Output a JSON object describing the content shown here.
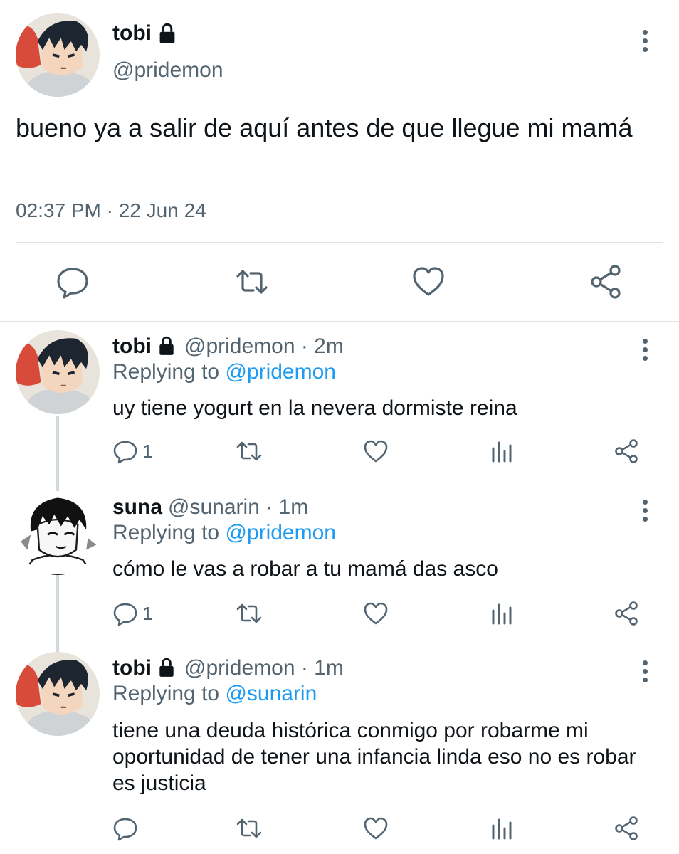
{
  "main_tweet": {
    "display_name": "tobi",
    "handle": "@pridemon",
    "text": "bueno ya a salir de aquí antes de que llegue mi mamá",
    "timestamp": "02:37 PM · 22 Jun 24",
    "icons": [
      "lock-icon",
      "more-icon",
      "reply-icon",
      "retweet-icon",
      "like-icon",
      "share-icon"
    ]
  },
  "replies": [
    {
      "display_name": "tobi",
      "handle_time": "@pridemon · 2m",
      "replying_prefix": "Replying to",
      "replying_to": "@pridemon",
      "text": "uy tiene yogurt en la nevera dormiste reina",
      "reply_count": "1",
      "protected": true
    },
    {
      "display_name": "suna",
      "handle_time": "@sunarin · 1m",
      "replying_prefix": "Replying to",
      "replying_to": "@pridemon",
      "text": "cómo le vas a robar a tu mamá das asco",
      "reply_count": "1",
      "protected": false
    },
    {
      "display_name": "tobi",
      "handle_time": "@pridemon · 1m",
      "replying_prefix": "Replying to",
      "replying_to": "@sunarin",
      "text": "tiene una deuda histórica conmigo por robarme mi oportunidad de tener una infancia linda eso no es robar es justicia",
      "reply_count": "",
      "protected": true
    }
  ],
  "colors": {
    "text": "#0f1419",
    "secondary": "#536471",
    "mention": "#1d9bf0",
    "divider": "#dfe3e7",
    "thread_line": "#cfd9de"
  }
}
